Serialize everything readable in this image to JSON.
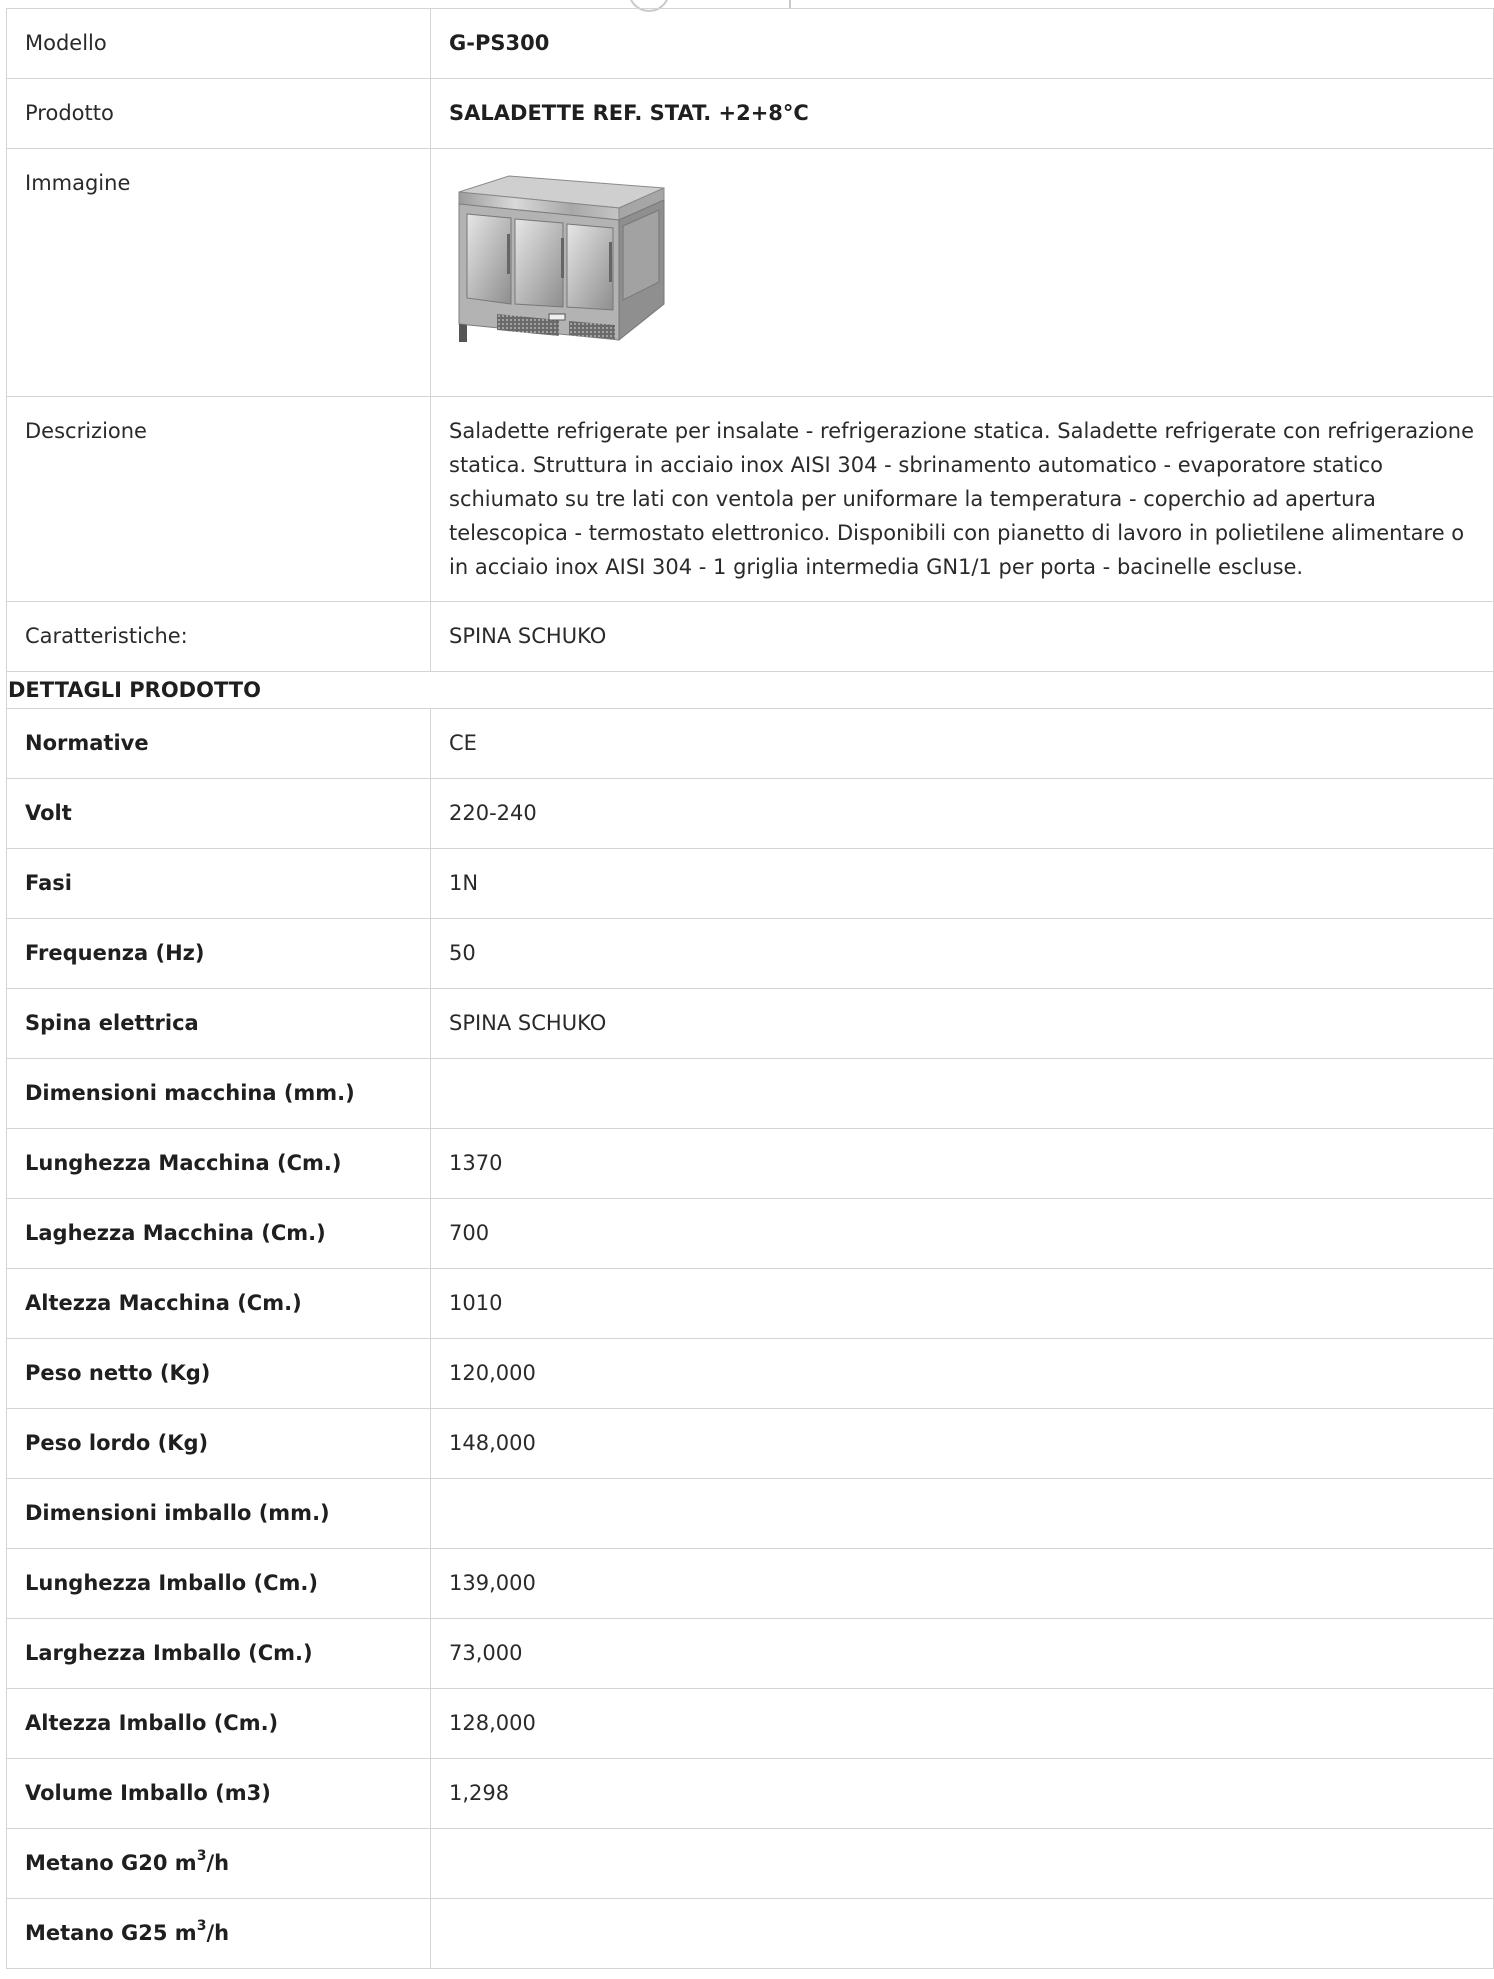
{
  "product": {
    "model_label": "Modello",
    "model_value": "G-PS300",
    "product_label": "Prodotto",
    "product_value": "SALADETTE REF. STAT. +2+8°C",
    "image_label": "Immagine",
    "image_icon": "saladette-fridge-image",
    "description_label": "Descrizione",
    "description_value": "Saladette refrigerate per insalate - refrigerazione statica. Saladette refrigerate con refrigerazione statica. Struttura in acciaio inox AISI 304 - sbrinamento automatico - evaporatore statico schiumato su tre lati con ventola per uniformare la temperatura - coperchio ad apertura telescopica - termostato elettronico. Disponibili con pianetto di lavoro in polietilene alimentare o in acciaio inox AISI 304 - 1 griglia intermedia GN1/1 per porta - bacinelle escluse.",
    "features_label": "Caratteristiche:",
    "features_value": "SPINA SCHUKO"
  },
  "details": {
    "section_title": "DETTAGLI PRODOTTO",
    "rows": [
      {
        "label": "Normative",
        "value": "CE"
      },
      {
        "label": "Volt",
        "value": "220-240"
      },
      {
        "label": "Fasi",
        "value": "1N"
      },
      {
        "label": "Frequenza (Hz)",
        "value": "50"
      },
      {
        "label": "Spina elettrica",
        "value": "SPINA SCHUKO"
      },
      {
        "label": "Dimensioni macchina (mm.)",
        "value": ""
      },
      {
        "label": "Lunghezza Macchina (Cm.)",
        "value": "1370"
      },
      {
        "label": "Laghezza Macchina (Cm.)",
        "value": "700"
      },
      {
        "label": "Altezza Macchina (Cm.)",
        "value": "1010"
      },
      {
        "label": "Peso netto (Kg)",
        "value": "120,000"
      },
      {
        "label": "Peso lordo (Kg)",
        "value": "148,000"
      },
      {
        "label": "Dimensioni imballo (mm.)",
        "value": ""
      },
      {
        "label": "Lunghezza Imballo (Cm.)",
        "value": "139,000"
      },
      {
        "label": "Larghezza Imballo (Cm.)",
        "value": "73,000"
      },
      {
        "label": "Altezza Imballo (Cm.)",
        "value": "128,000"
      },
      {
        "label": "Volume Imballo (m3)",
        "value": "1,298"
      }
    ],
    "gas_rows": [
      {
        "label_prefix": "Metano G20 m",
        "label_sup": "3",
        "label_suffix": "/h",
        "value": ""
      },
      {
        "label_prefix": "Metano G25 m",
        "label_sup": "3",
        "label_suffix": "/h",
        "value": ""
      }
    ]
  }
}
